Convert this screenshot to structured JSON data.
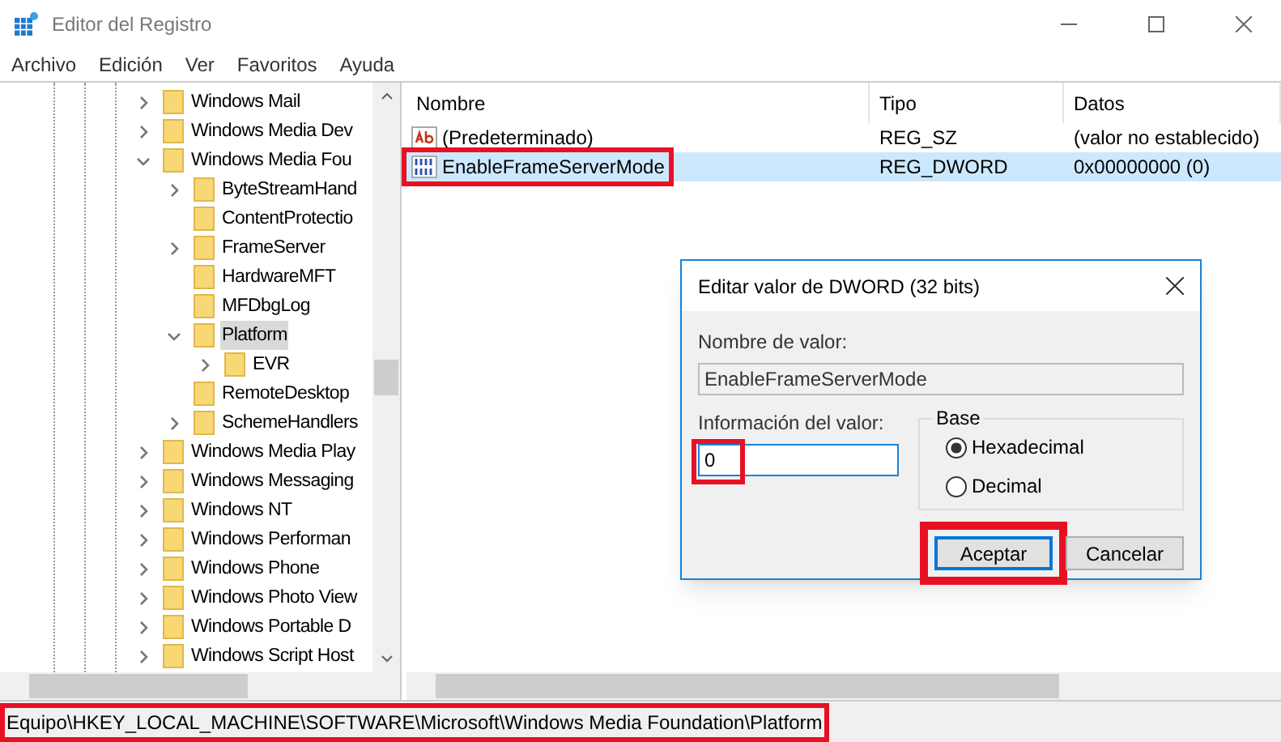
{
  "window": {
    "title": "Editor del Registro"
  },
  "menu": [
    "Archivo",
    "Edición",
    "Ver",
    "Favoritos",
    "Ayuda"
  ],
  "tree": [
    {
      "label": "Windows Mail",
      "expanded": false,
      "selected": false
    },
    {
      "label": "Windows Media Dev",
      "expanded": false,
      "selected": false
    },
    {
      "label": "Windows Media Fou",
      "expanded": true,
      "selected": false,
      "children": [
        {
          "label": "ByteStreamHand",
          "expanded": false,
          "selected": false
        },
        {
          "label": "ContentProtectio",
          "selected": false
        },
        {
          "label": "FrameServer",
          "expanded": false,
          "selected": false
        },
        {
          "label": "HardwareMFT",
          "selected": false
        },
        {
          "label": "MFDbgLog",
          "selected": false
        },
        {
          "label": "Platform",
          "expanded": true,
          "selected": true,
          "children": [
            {
              "label": "EVR",
              "expanded": false,
              "selected": false
            }
          ]
        },
        {
          "label": "RemoteDesktop",
          "selected": false
        },
        {
          "label": "SchemeHandlers",
          "expanded": false,
          "selected": false
        }
      ]
    },
    {
      "label": "Windows Media Play",
      "expanded": false,
      "selected": false
    },
    {
      "label": "Windows Messaging",
      "expanded": false,
      "selected": false
    },
    {
      "label": "Windows NT",
      "expanded": false,
      "selected": false
    },
    {
      "label": "Windows Performan",
      "expanded": false,
      "selected": false
    },
    {
      "label": "Windows Phone",
      "expanded": false,
      "selected": false
    },
    {
      "label": "Windows Photo View",
      "expanded": false,
      "selected": false
    },
    {
      "label": "Windows Portable D",
      "expanded": false,
      "selected": false
    },
    {
      "label": "Windows Script Host",
      "expanded": false,
      "selected": false
    }
  ],
  "table": {
    "columns": [
      "Nombre",
      "Tipo",
      "Datos"
    ],
    "rows": [
      {
        "kind": "string",
        "name": "(Predeterminado)",
        "type": "REG_SZ",
        "data": "(valor no establecido)",
        "selected": false,
        "highlighted": false
      },
      {
        "kind": "binary",
        "name": "EnableFrameServerMode",
        "type": "REG_DWORD",
        "data": "0x00000000 (0)",
        "selected": true,
        "highlighted": true
      }
    ]
  },
  "dialog": {
    "title": "Editar valor de DWORD (32 bits)",
    "name_label": "Nombre de valor:",
    "name_value": "EnableFrameServerMode",
    "value_label": "Información del valor:",
    "value": "0",
    "value_highlighted": true,
    "base_label": "Base",
    "radios": [
      {
        "label": "Hexadecimal",
        "selected": true
      },
      {
        "label": "Decimal",
        "selected": false
      }
    ],
    "buttons": [
      {
        "label": "Aceptar",
        "default": true,
        "highlighted": true
      },
      {
        "label": "Cancelar",
        "default": false,
        "highlighted": false
      }
    ]
  },
  "status_bar": {
    "path": "Equipo\\HKEY_LOCAL_MACHINE\\SOFTWARE\\Microsoft\\Windows Media Foundation\\Platform",
    "highlighted": true
  }
}
